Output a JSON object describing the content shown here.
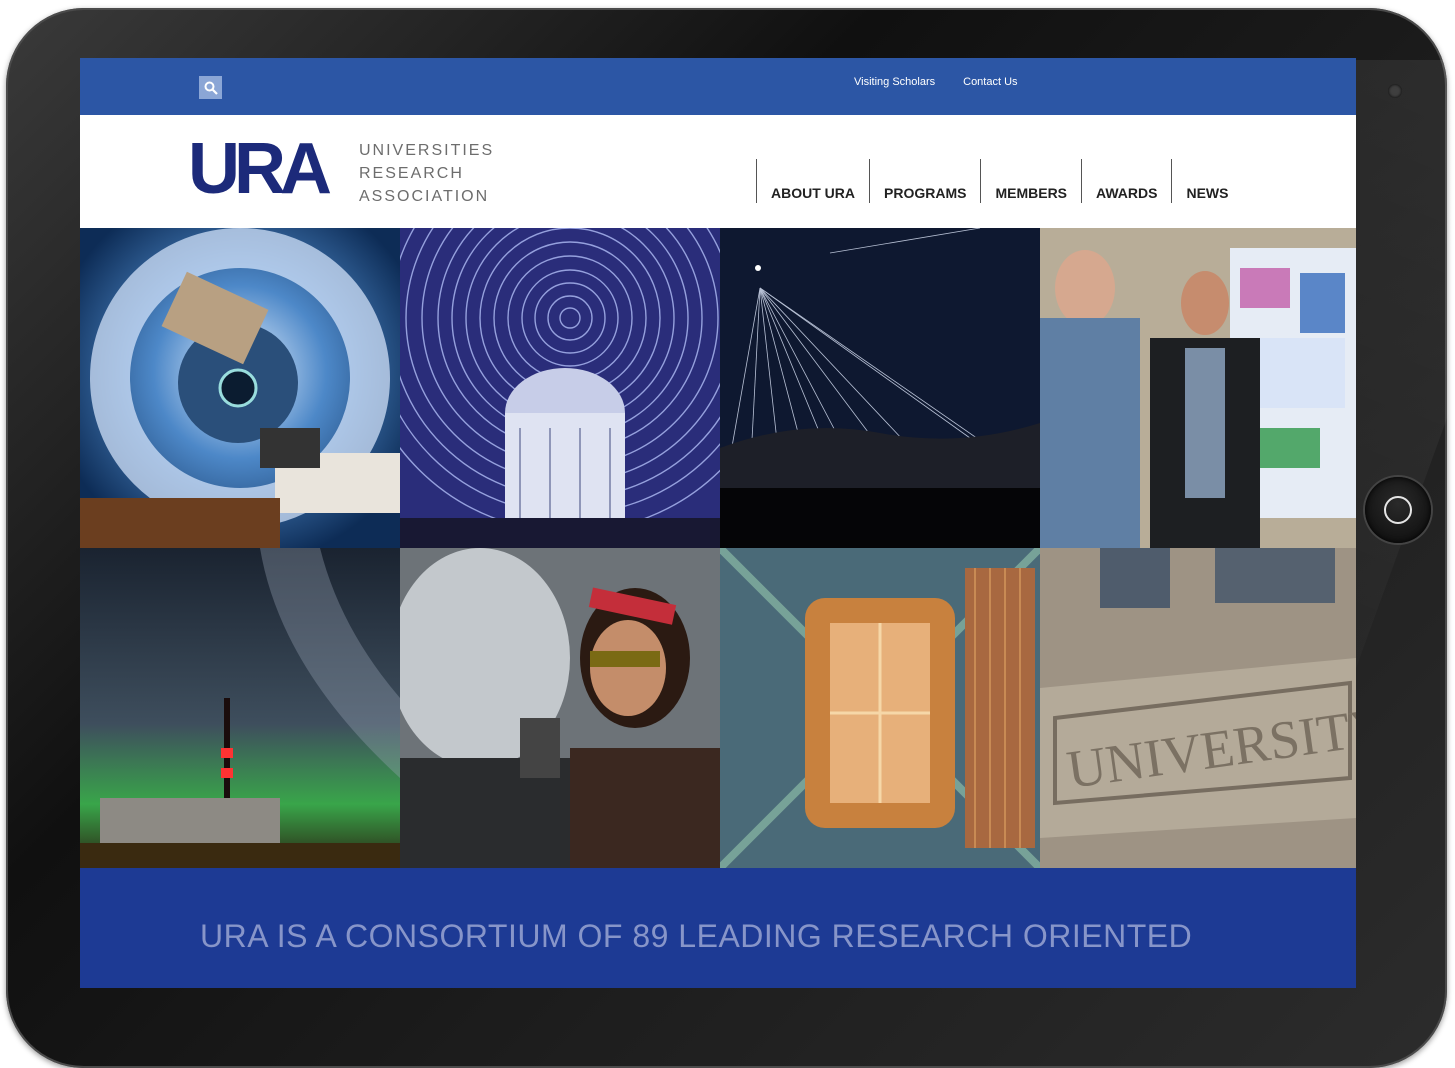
{
  "topbar": {
    "links": [
      "Visiting Scholars",
      "Contact Us"
    ]
  },
  "logo": {
    "mark": "URA",
    "lines": [
      "UNIVERSITIES",
      "RESEARCH",
      "ASSOCIATION"
    ]
  },
  "nav": {
    "items": [
      "ABOUT URA",
      "PROGRAMS",
      "MEMBERS",
      "AWARDS",
      "NEWS"
    ]
  },
  "tiles": {
    "signs": {
      "building_text": "UNIVERSITY"
    }
  },
  "banner": {
    "text": "URA IS A CONSORTIUM OF 89 LEADING RESEARCH ORIENTED"
  },
  "colors": {
    "topbar": "#2c56a5",
    "brand": "#1c2a7a",
    "banner": "#1d3a94"
  }
}
